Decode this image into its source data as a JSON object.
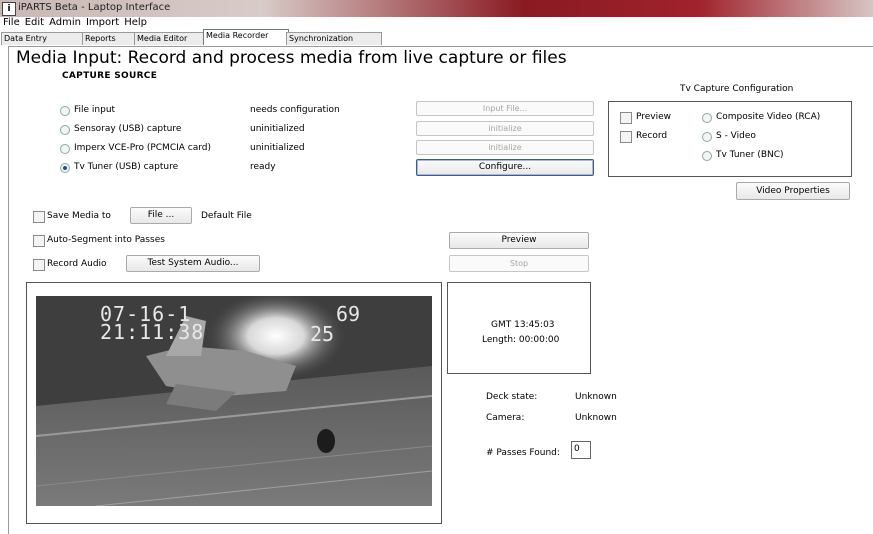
{
  "window": {
    "title": "iPARTS Beta - Laptop Interface"
  },
  "menu": [
    "File",
    "Edit",
    "Admin",
    "Import",
    "Help"
  ],
  "tabs": [
    "Data Entry",
    "Reports",
    "Media Editor",
    "Media Recorder",
    "Synchronization"
  ],
  "active_tab": "Media Recorder",
  "heading": "Media Input:  Record and process media from live capture or files",
  "capture_source": {
    "title": "CAPTURE SOURCE",
    "sources": [
      {
        "label": "File input",
        "status": "needs configuration",
        "button": "Input File...",
        "button_enabled": false,
        "selected": false
      },
      {
        "label": "Sensoray (USB) capture",
        "status": "uninitialized",
        "button": "initialize",
        "button_enabled": false,
        "selected": false
      },
      {
        "label": "Imperx VCE-Pro (PCMCIA card)",
        "status": "uninitialized",
        "button": "initialize",
        "button_enabled": false,
        "selected": false
      },
      {
        "label": "Tv Tuner (USB) capture",
        "status": "ready",
        "button": "Configure...",
        "button_enabled": true,
        "selected": true
      }
    ]
  },
  "tv_config": {
    "title": "Tv Capture Configuration",
    "preview_label": "Preview",
    "record_label": "Record",
    "inputs": [
      "Composite Video (RCA)",
      "S - Video",
      "Tv Tuner (BNC)"
    ],
    "video_properties_button": "Video Properties"
  },
  "options": {
    "save_media_label": "Save Media to",
    "file_button": "File ...",
    "default_file": "Default File",
    "auto_segment_label": "Auto-Segment into Passes",
    "record_audio_label": "Record Audio",
    "test_audio_button": "Test System Audio..."
  },
  "controls": {
    "preview_button": "Preview",
    "stop_button": "Stop"
  },
  "video_overlay": {
    "line1_left": "07-16-1",
    "line1_right": "69",
    "line2_left": "21:11:38",
    "line2_right": "25"
  },
  "info": {
    "gmt": "GMT 13:45:03",
    "length": "Length: 00:00:00"
  },
  "status": {
    "deck_state_label": "Deck state:",
    "deck_state_value": "Unknown",
    "camera_label": "Camera:",
    "camera_value": "Unknown",
    "passes_label": "# Passes Found:",
    "passes_value": "0"
  }
}
